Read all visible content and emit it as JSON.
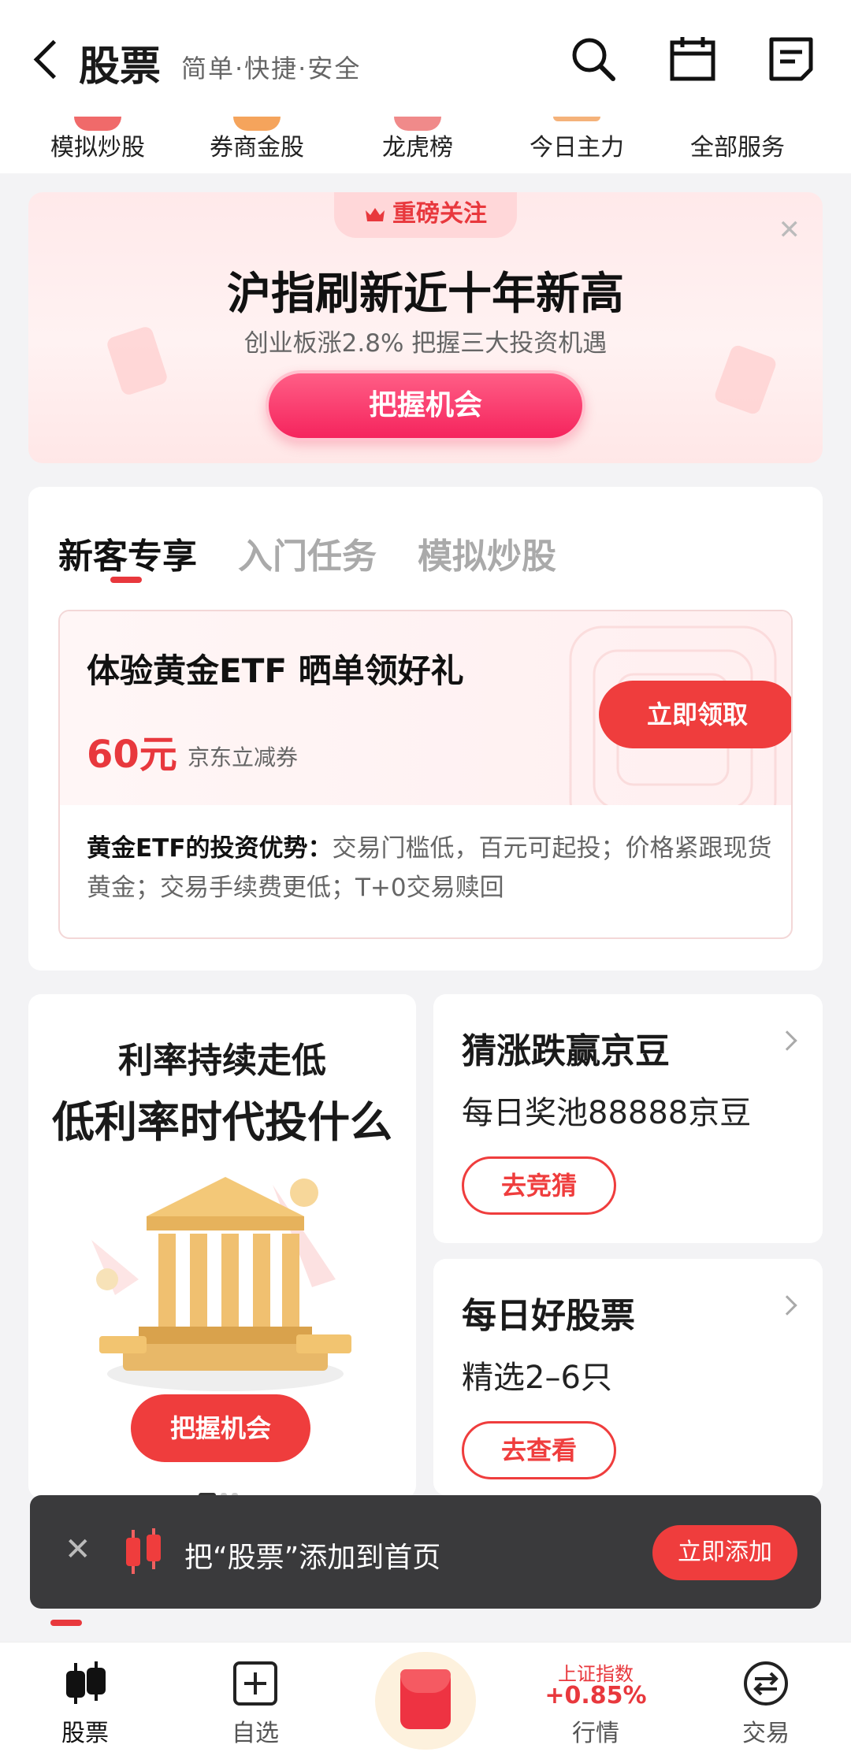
{
  "header": {
    "title": "股票",
    "subtitle": "简单·快捷·安全"
  },
  "services": [
    "模拟炒股",
    "券商金股",
    "龙虎榜",
    "今日主力",
    "全部服务"
  ],
  "banner": {
    "tag": "重磅关注",
    "title": "沪指刷新近十年新高",
    "subtitle": "创业板涨2.8% 把握三大投资机遇",
    "button": "把握机会"
  },
  "tabs": [
    "新客专享",
    "入门任务",
    "模拟炒股"
  ],
  "promo": {
    "title": "体验黄金ETF 晒单领好礼",
    "amount": "60元",
    "amount_note": "京东立减券",
    "button": "立即领取",
    "desc_bold": "黄金ETF的投资优势：",
    "desc": "交易门槛低，百元可起投；价格紧跟现货黄金；交易手续费更低；T+0交易赎回"
  },
  "left_card": {
    "title1": "利率持续走低",
    "title2": "低利率时代投什么",
    "button": "把握机会"
  },
  "right_cards": [
    {
      "title": "猜涨跌赢京豆",
      "subtitle": "每日奖池88888京豆",
      "button": "去竞猜"
    },
    {
      "title": "每日好股票",
      "subtitle": "精选2–6只",
      "button": "去查看"
    }
  ],
  "toast": {
    "text": "把“股票”添加到首页",
    "button": "立即添加"
  },
  "bottom_nav": {
    "stocks": "股票",
    "watchlist": "自选",
    "index_name": "上证指数",
    "index_value": "+0.85%",
    "market": "行情",
    "trade": "交易"
  },
  "colors": {
    "accent": "#ef3d3d",
    "accent_pink": "#f5245d"
  }
}
